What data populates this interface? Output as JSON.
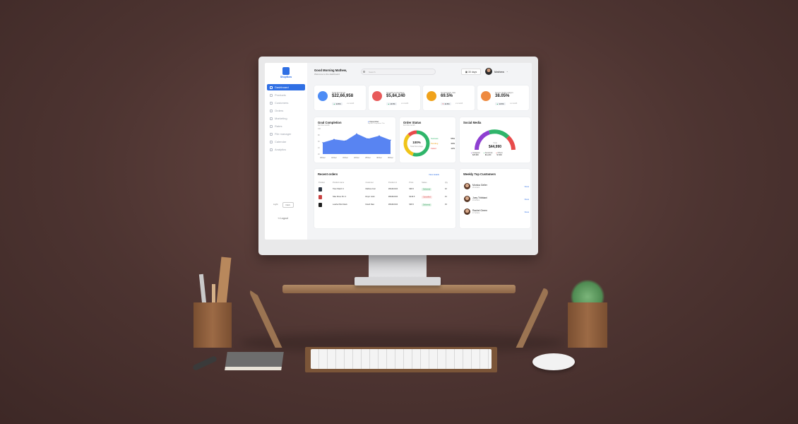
{
  "app": {
    "brand": "ShopNow",
    "greeting": "Good Morning Mathew,",
    "greeting_sub": "Welcome to the dashboard",
    "search_placeholder": "Search",
    "date_range": "30 days",
    "user_name": "Mathew"
  },
  "sidebar": {
    "items": [
      {
        "label": "Dashboard",
        "active": true
      },
      {
        "label": "Products"
      },
      {
        "label": "Customers"
      },
      {
        "label": "Orders"
      },
      {
        "label": "Marketing"
      },
      {
        "label": "Rates"
      },
      {
        "label": "File manager"
      },
      {
        "label": "Calendar"
      },
      {
        "label": "Analytics"
      }
    ],
    "theme_light": "Light",
    "theme_dark": "Dark",
    "logout": "Logout"
  },
  "kpis": [
    {
      "label": "Total Earnings",
      "value": "$22,66,958",
      "change": "14.8%",
      "note": "v.s month",
      "color": "#4d8cf5"
    },
    {
      "label": "Growth percentage",
      "value": "$5,84,240",
      "change": "14.8%",
      "note": "v.s month",
      "color": "#e85a5a"
    },
    {
      "label": "Conversion rate",
      "value": "69.5%",
      "change": "14.8%",
      "note": "v.s month",
      "color": "#f0a21b"
    },
    {
      "label": "Gross profit margin",
      "value": "38.05%",
      "change": "14.8%",
      "note": "v.s month",
      "color": "#ee8a40"
    }
  ],
  "goal": {
    "title": "Goal Completion",
    "subtitle": "For this month",
    "legend": "December",
    "legend_sub": "Big Bell Completion This",
    "x_labels": [
      "05 Dec",
      "10 Dec",
      "15 Dec",
      "20 Dec",
      "25 Dec",
      "30 Dec",
      "05 Dec"
    ],
    "y_labels": [
      "100",
      "80",
      "60",
      "40",
      "20"
    ]
  },
  "chart_data": {
    "type": "area",
    "x": [
      "05 Dec",
      "10 Dec",
      "15 Dec",
      "20 Dec",
      "25 Dec",
      "30 Dec",
      "05 Dec"
    ],
    "series": [
      {
        "values": [
          45,
          58,
          52,
          80,
          60,
          72,
          55
        ]
      }
    ],
    "ylim": [
      0,
      100
    ]
  },
  "order_status": {
    "title": "Order Status",
    "subtitle": "For this month",
    "center_value": "100%",
    "center_label": "Total Percentage",
    "items": [
      {
        "label": "Success",
        "value": "55%",
        "color": "#2fb56a"
      },
      {
        "label": "Pending",
        "value": "33%",
        "color": "#f0c419"
      },
      {
        "label": "Failed",
        "value": "12%",
        "color": "#e84b4b"
      }
    ]
  },
  "social": {
    "title": "Social Media",
    "center_label": "Total",
    "center_value": "$44,990",
    "items": [
      {
        "label": "Instagram",
        "value": "$25,990",
        "color": "#8e3fd1"
      },
      {
        "label": "Facebook",
        "value": "$11,200",
        "color": "#2fb56a"
      },
      {
        "label": "Others",
        "value": "$7,800",
        "color": "#e84b4b"
      }
    ]
  },
  "orders": {
    "title": "Recent orders",
    "view_all": "View details",
    "headers": [
      "Product",
      "Product name",
      "Customer",
      "Product id",
      "Price",
      "Status",
      "Qty"
    ],
    "rows": [
      {
        "name": "Titan Watch 3",
        "customer": "Mathew Farr",
        "id": "#MHD2234",
        "price": "$99.5",
        "status": "Delivered",
        "qty": "02"
      },
      {
        "name": "Nike Shoe Pro 3",
        "customer": "Ruyin Gold",
        "id": "#MHD2234",
        "price": "$149.5",
        "status": "Cancelled",
        "qty": "01"
      },
      {
        "name": "Leather Belt black",
        "customer": "David Raw",
        "id": "#MHD2234",
        "price": "$99.5",
        "status": "Delivered",
        "qty": "03"
      }
    ]
  },
  "top_customers": {
    "title": "Weekly Top Customers",
    "items": [
      {
        "name": "Monica Geller",
        "sub": "26 orders",
        "action": "View"
      },
      {
        "name": "Joey Tribbiani",
        "sub": "24 orders",
        "action": "View"
      },
      {
        "name": "Rachel Green",
        "sub": "17 orders",
        "action": "View"
      }
    ]
  }
}
